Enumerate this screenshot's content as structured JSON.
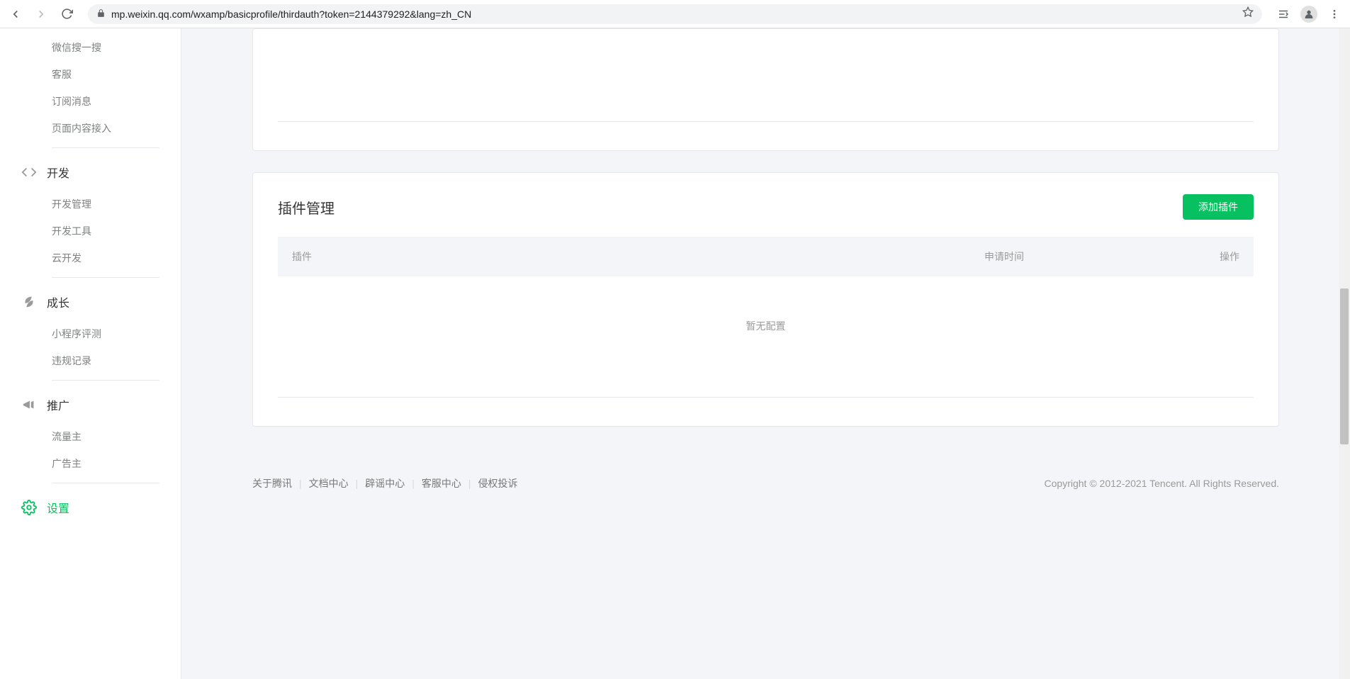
{
  "browser": {
    "url": "mp.weixin.qq.com/wxamp/basicprofile/thirdauth?token=2144379292&lang=zh_CN"
  },
  "sidebar": {
    "top_items": [
      "微信搜一搜",
      "客服",
      "订阅消息",
      "页面内容接入"
    ],
    "groups": [
      {
        "title": "开发",
        "items": [
          "开发管理",
          "开发工具",
          "云开发"
        ]
      },
      {
        "title": "成长",
        "items": [
          "小程序评测",
          "违规记录"
        ]
      },
      {
        "title": "推广",
        "items": [
          "流量主",
          "广告主"
        ]
      }
    ],
    "settings": "设置"
  },
  "main": {
    "section_title": "插件管理",
    "add_button": "添加插件",
    "table": {
      "col_plugin": "插件",
      "col_time": "申请时间",
      "col_action": "操作",
      "empty": "暂无配置"
    }
  },
  "footer": {
    "links": [
      "关于腾讯",
      "文档中心",
      "辟谣中心",
      "客服中心",
      "侵权投诉"
    ],
    "copyright": "Copyright © 2012-2021 Tencent. All Rights Reserved."
  }
}
